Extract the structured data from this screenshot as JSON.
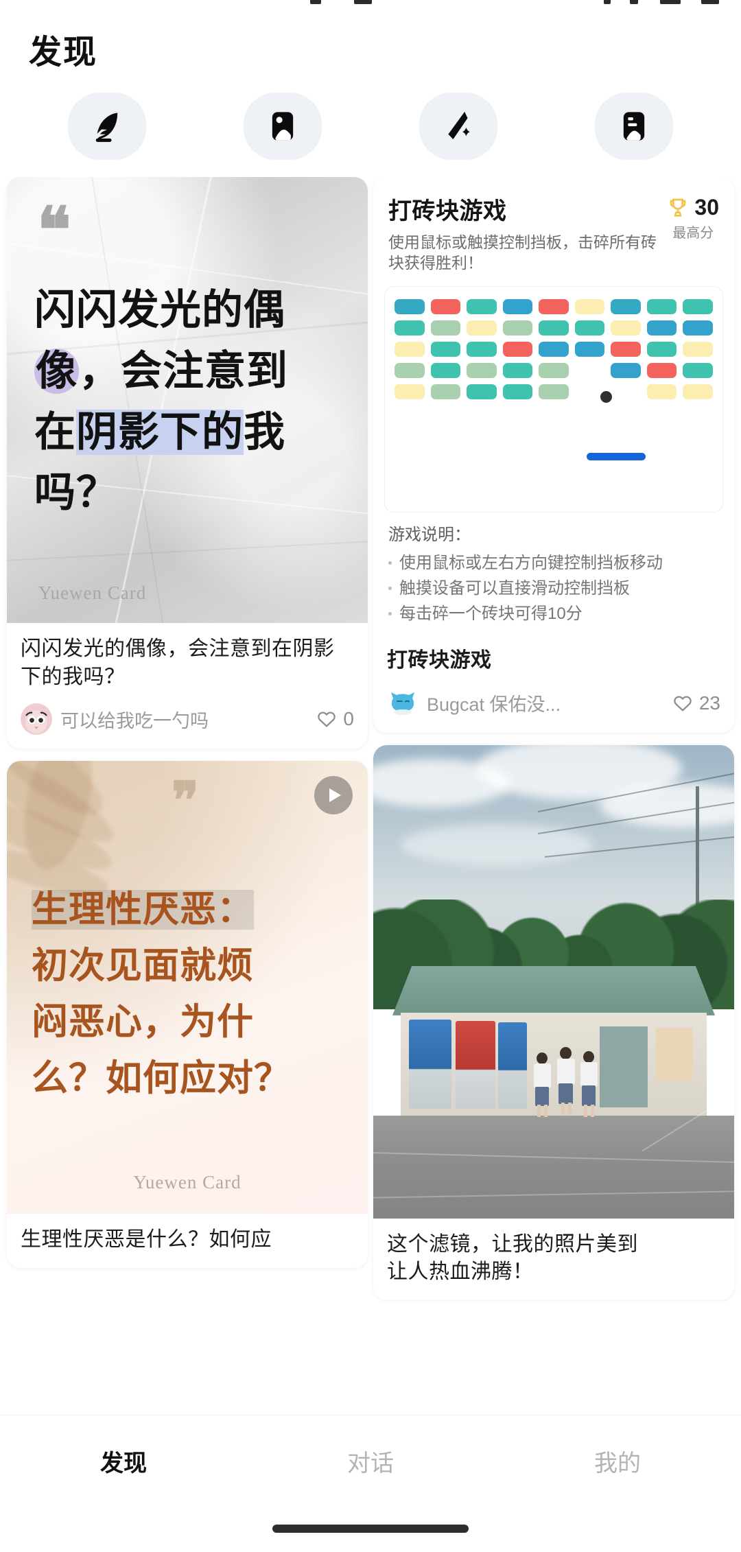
{
  "header": {
    "title": "发现"
  },
  "quick_actions": [
    {
      "label": "帮我写作",
      "icon": "feather-pen-icon"
    },
    {
      "label": "帮我生图",
      "icon": "image-generate-icon"
    },
    {
      "label": "添加滤镜",
      "icon": "magic-wand-filter-icon"
    },
    {
      "label": "图片配文",
      "icon": "image-caption-icon"
    }
  ],
  "cards": {
    "quote_grey": {
      "poster_lines": [
        {
          "segments": [
            {
              "text": "闪闪发光的偶",
              "hl": "none"
            }
          ]
        },
        {
          "segments": [
            {
              "text": "像",
              "hl": "purple"
            },
            {
              "text": "，会注意到",
              "hl": "none"
            }
          ]
        },
        {
          "segments": [
            {
              "text": "在",
              "hl": "none"
            },
            {
              "text": "阴影下的",
              "hl": "blue"
            },
            {
              "text": "我",
              "hl": "none"
            }
          ]
        },
        {
          "segments": [
            {
              "text": "吗？",
              "hl": "none"
            }
          ]
        }
      ],
      "watermark": "Yuewen Card",
      "quote_glyph": "❝",
      "title": "闪闪发光的偶像，会注意到在阴影下的我吗？",
      "author": "可以给我吃一勺吗",
      "likes": "0"
    },
    "game": {
      "title": "打砖块游戏",
      "subtitle": "使用鼠标或触摸控制挡板，击碎所有砖块获得胜利！",
      "score_label": "最高分",
      "score_value": "30",
      "score_icon": "trophy-icon",
      "rules_heading": "游戏说明：",
      "rules": [
        "使用鼠标或左右方向键控制挡板移动",
        "触摸设备可以直接滑动控制挡板",
        "每击碎一个砖块可得10分"
      ],
      "footer_title": "打砖块游戏",
      "author": "Bugcat 保佑没...",
      "likes": "23"
    },
    "quote_beige": {
      "poster_lines": [
        {
          "segments": [
            {
              "text": "生理性厌恶：",
              "hl": "grey"
            }
          ]
        },
        {
          "segments": [
            {
              "text": "初次见面就烦",
              "hl": "none"
            }
          ]
        },
        {
          "segments": [
            {
              "text": "闷恶心，为什",
              "hl": "none"
            }
          ]
        },
        {
          "segments": [
            {
              "text": "么？如何应对？",
              "hl": "none"
            }
          ]
        }
      ],
      "watermark": "Yuewen Card",
      "quote_glyph": "❞",
      "title": "生理性厌恶是什么？如何应",
      "has_video": true
    },
    "photo": {
      "title_line1": "这个滤镜，让我的照片美到",
      "title_line2": "让人热血沸腾！"
    }
  },
  "game_board": {
    "rows": [
      [
        "#35a8c4",
        "#f4625e",
        "#3fc2ae",
        "#33a2cd",
        "#f4625e",
        "#fbeeb0",
        "#35a8c4",
        "#3fc2ae",
        "#3fc2ae"
      ],
      [
        "#3fc2ae",
        "#a8cfae",
        "#fbeeb0",
        "#a8cfae",
        "#3fc2ae",
        "#3fc2ae",
        "#fbeeb0",
        "#33a2cd",
        "#33a2cd"
      ],
      [
        "#fbeeb0",
        "#3fc2ae",
        "#3fc2ae",
        "#f4625e",
        "#33a2cd",
        "#33a2cd",
        "#f4625e",
        "#3fc2ae",
        "#fbeeb0"
      ],
      [
        "#a8cfae",
        "#3fc2ae",
        "#a8cfae",
        "#3fc2ae",
        "#a8cfae",
        "none",
        "#33a2cd",
        "#f4625e",
        "#3fc2ae"
      ],
      [
        "#fbeeb0",
        "#a8cfae",
        "#3fc2ae",
        "#3fc2ae",
        "#a8cfae",
        "none",
        "none",
        "#fbeeb0",
        "#fbeeb0"
      ]
    ],
    "ball_color": "#2f2f2f",
    "paddle_color": "#1565d8"
  },
  "tabbar": {
    "items": [
      {
        "label": "发现",
        "active": true
      },
      {
        "label": "对话",
        "active": false
      },
      {
        "label": "我的",
        "active": false
      }
    ]
  },
  "colors": {
    "accent_purple": "#c9bde8",
    "accent_blue": "#c6d2ef",
    "beige_text": "#a7541f",
    "trophy_gold": "#f2c24a",
    "paddle_blue": "#1565d8"
  }
}
